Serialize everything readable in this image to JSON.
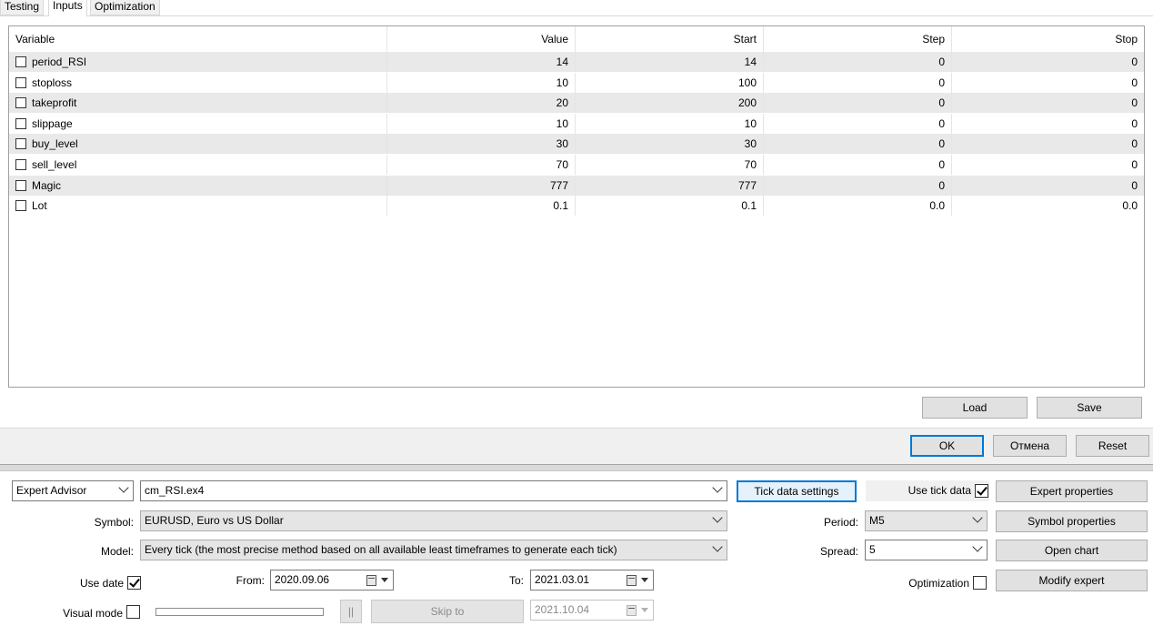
{
  "tabs": [
    "Testing",
    "Inputs",
    "Optimization"
  ],
  "grid": {
    "columns": [
      "Variable",
      "Value",
      "Start",
      "Step",
      "Stop"
    ],
    "rows": [
      {
        "name": "period_RSI",
        "value": "14",
        "start": "14",
        "step": "0",
        "stop": "0"
      },
      {
        "name": "stoploss",
        "value": "10",
        "start": "100",
        "step": "0",
        "stop": "0"
      },
      {
        "name": "takeprofit",
        "value": "20",
        "start": "200",
        "step": "0",
        "stop": "0"
      },
      {
        "name": "slippage",
        "value": "10",
        "start": "10",
        "step": "0",
        "stop": "0"
      },
      {
        "name": "buy_level",
        "value": "30",
        "start": "30",
        "step": "0",
        "stop": "0"
      },
      {
        "name": "sell_level",
        "value": "70",
        "start": "70",
        "step": "0",
        "stop": "0"
      },
      {
        "name": "Magic",
        "value": "777",
        "start": "777",
        "step": "0",
        "stop": "0"
      },
      {
        "name": "Lot",
        "value": "0.1",
        "start": "0.1",
        "step": "0.0",
        "stop": "0.0"
      }
    ]
  },
  "buttons": {
    "load": "Load",
    "save": "Save",
    "ok": "OK",
    "cancel": "Отмена",
    "reset": "Reset"
  },
  "settings": {
    "type_select": "Expert Advisor",
    "expert_file": "cm_RSI.ex4",
    "tick_data_settings": "Tick data settings",
    "use_tick_data_label": "Use tick data",
    "use_tick_data": true,
    "expert_properties": "Expert properties",
    "symbol_label": "Symbol:",
    "symbol_value": "EURUSD, Euro vs US Dollar",
    "period_label": "Period:",
    "period_value": "M5",
    "symbol_properties": "Symbol properties",
    "model_label": "Model:",
    "model_value": "Every tick (the most precise method based on all available least timeframes to generate each tick)",
    "spread_label": "Spread:",
    "spread_value": "5",
    "open_chart": "Open chart",
    "use_date_label": "Use date",
    "use_date": true,
    "from_label": "From:",
    "from_value": "2020.09.06",
    "to_label": "To:",
    "to_value": "2021.03.01",
    "optimization_label": "Optimization",
    "optimization": false,
    "modify_expert": "Modify expert",
    "visual_mode_label": "Visual mode",
    "visual_mode": false,
    "pause_symbol": "||",
    "skip_to": "Skip to",
    "skip_date": "2021.10.04"
  }
}
